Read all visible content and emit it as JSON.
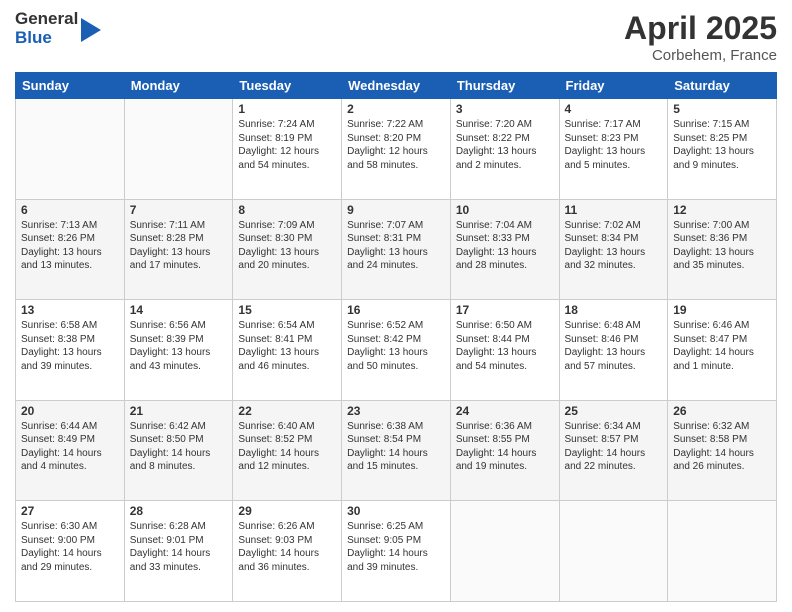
{
  "logo": {
    "general": "General",
    "blue": "Blue"
  },
  "title": {
    "month_year": "April 2025",
    "location": "Corbehem, France"
  },
  "days_of_week": [
    "Sunday",
    "Monday",
    "Tuesday",
    "Wednesday",
    "Thursday",
    "Friday",
    "Saturday"
  ],
  "weeks": [
    [
      {
        "day": "",
        "info": ""
      },
      {
        "day": "",
        "info": ""
      },
      {
        "day": "1",
        "info": "Sunrise: 7:24 AM\nSunset: 8:19 PM\nDaylight: 12 hours and 54 minutes."
      },
      {
        "day": "2",
        "info": "Sunrise: 7:22 AM\nSunset: 8:20 PM\nDaylight: 12 hours and 58 minutes."
      },
      {
        "day": "3",
        "info": "Sunrise: 7:20 AM\nSunset: 8:22 PM\nDaylight: 13 hours and 2 minutes."
      },
      {
        "day": "4",
        "info": "Sunrise: 7:17 AM\nSunset: 8:23 PM\nDaylight: 13 hours and 5 minutes."
      },
      {
        "day": "5",
        "info": "Sunrise: 7:15 AM\nSunset: 8:25 PM\nDaylight: 13 hours and 9 minutes."
      }
    ],
    [
      {
        "day": "6",
        "info": "Sunrise: 7:13 AM\nSunset: 8:26 PM\nDaylight: 13 hours and 13 minutes."
      },
      {
        "day": "7",
        "info": "Sunrise: 7:11 AM\nSunset: 8:28 PM\nDaylight: 13 hours and 17 minutes."
      },
      {
        "day": "8",
        "info": "Sunrise: 7:09 AM\nSunset: 8:30 PM\nDaylight: 13 hours and 20 minutes."
      },
      {
        "day": "9",
        "info": "Sunrise: 7:07 AM\nSunset: 8:31 PM\nDaylight: 13 hours and 24 minutes."
      },
      {
        "day": "10",
        "info": "Sunrise: 7:04 AM\nSunset: 8:33 PM\nDaylight: 13 hours and 28 minutes."
      },
      {
        "day": "11",
        "info": "Sunrise: 7:02 AM\nSunset: 8:34 PM\nDaylight: 13 hours and 32 minutes."
      },
      {
        "day": "12",
        "info": "Sunrise: 7:00 AM\nSunset: 8:36 PM\nDaylight: 13 hours and 35 minutes."
      }
    ],
    [
      {
        "day": "13",
        "info": "Sunrise: 6:58 AM\nSunset: 8:38 PM\nDaylight: 13 hours and 39 minutes."
      },
      {
        "day": "14",
        "info": "Sunrise: 6:56 AM\nSunset: 8:39 PM\nDaylight: 13 hours and 43 minutes."
      },
      {
        "day": "15",
        "info": "Sunrise: 6:54 AM\nSunset: 8:41 PM\nDaylight: 13 hours and 46 minutes."
      },
      {
        "day": "16",
        "info": "Sunrise: 6:52 AM\nSunset: 8:42 PM\nDaylight: 13 hours and 50 minutes."
      },
      {
        "day": "17",
        "info": "Sunrise: 6:50 AM\nSunset: 8:44 PM\nDaylight: 13 hours and 54 minutes."
      },
      {
        "day": "18",
        "info": "Sunrise: 6:48 AM\nSunset: 8:46 PM\nDaylight: 13 hours and 57 minutes."
      },
      {
        "day": "19",
        "info": "Sunrise: 6:46 AM\nSunset: 8:47 PM\nDaylight: 14 hours and 1 minute."
      }
    ],
    [
      {
        "day": "20",
        "info": "Sunrise: 6:44 AM\nSunset: 8:49 PM\nDaylight: 14 hours and 4 minutes."
      },
      {
        "day": "21",
        "info": "Sunrise: 6:42 AM\nSunset: 8:50 PM\nDaylight: 14 hours and 8 minutes."
      },
      {
        "day": "22",
        "info": "Sunrise: 6:40 AM\nSunset: 8:52 PM\nDaylight: 14 hours and 12 minutes."
      },
      {
        "day": "23",
        "info": "Sunrise: 6:38 AM\nSunset: 8:54 PM\nDaylight: 14 hours and 15 minutes."
      },
      {
        "day": "24",
        "info": "Sunrise: 6:36 AM\nSunset: 8:55 PM\nDaylight: 14 hours and 19 minutes."
      },
      {
        "day": "25",
        "info": "Sunrise: 6:34 AM\nSunset: 8:57 PM\nDaylight: 14 hours and 22 minutes."
      },
      {
        "day": "26",
        "info": "Sunrise: 6:32 AM\nSunset: 8:58 PM\nDaylight: 14 hours and 26 minutes."
      }
    ],
    [
      {
        "day": "27",
        "info": "Sunrise: 6:30 AM\nSunset: 9:00 PM\nDaylight: 14 hours and 29 minutes."
      },
      {
        "day": "28",
        "info": "Sunrise: 6:28 AM\nSunset: 9:01 PM\nDaylight: 14 hours and 33 minutes."
      },
      {
        "day": "29",
        "info": "Sunrise: 6:26 AM\nSunset: 9:03 PM\nDaylight: 14 hours and 36 minutes."
      },
      {
        "day": "30",
        "info": "Sunrise: 6:25 AM\nSunset: 9:05 PM\nDaylight: 14 hours and 39 minutes."
      },
      {
        "day": "",
        "info": ""
      },
      {
        "day": "",
        "info": ""
      },
      {
        "day": "",
        "info": ""
      }
    ]
  ]
}
